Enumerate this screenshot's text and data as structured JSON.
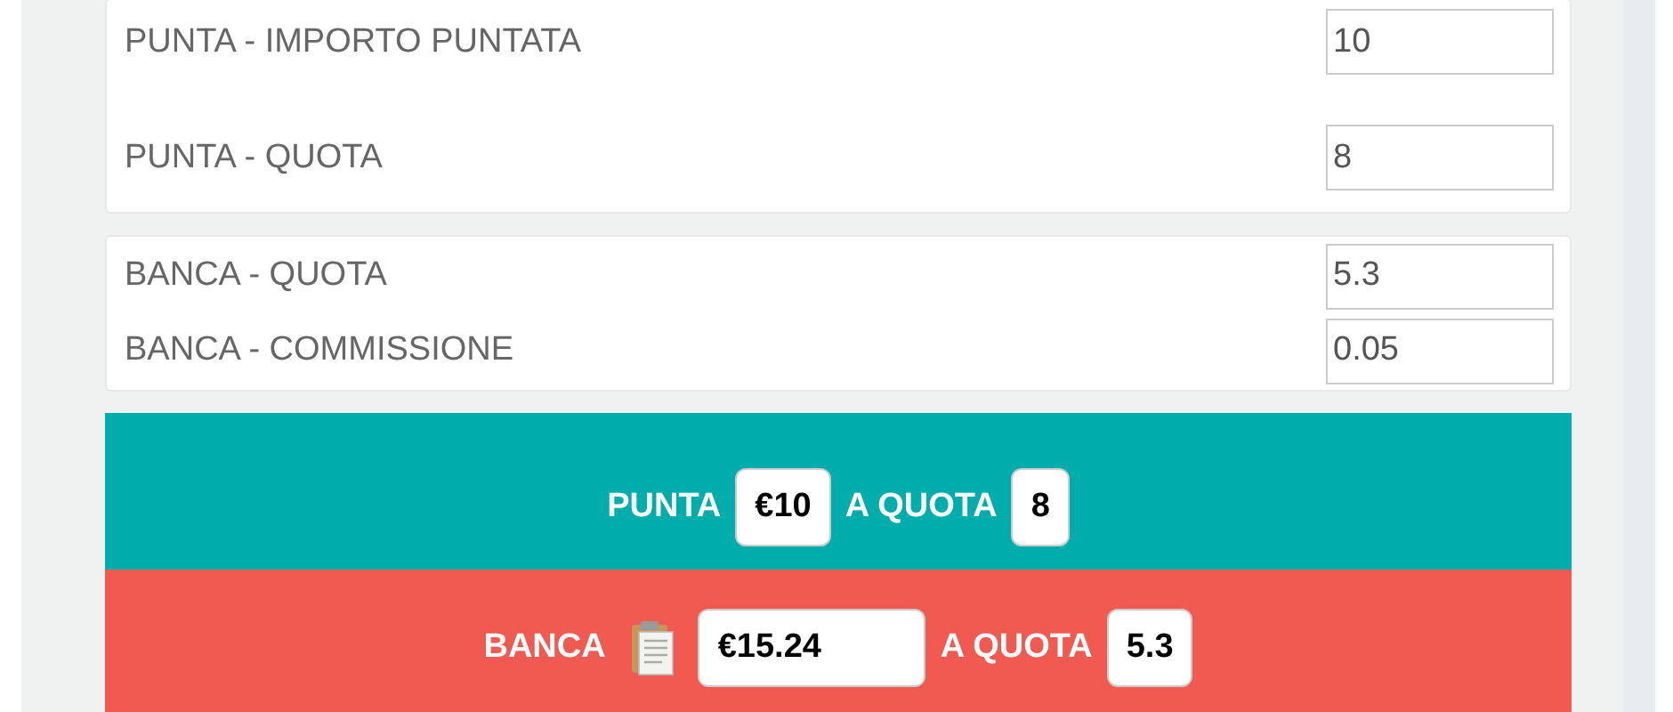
{
  "back_fields": [
    {
      "label": "PUNTA - IMPORTO PUNTATA",
      "value": "10"
    },
    {
      "label": "PUNTA - QUOTA",
      "value": "8"
    }
  ],
  "lay_fields": [
    {
      "label": "BANCA - QUOTA",
      "value": "5.3"
    },
    {
      "label": "BANCA - COMMISSIONE",
      "value": "0.05"
    }
  ],
  "back_result": {
    "label": "PUNTA",
    "amount": "€10",
    "odds_label": "A QUOTA",
    "odds": "8"
  },
  "lay_result": {
    "label": "BANCA",
    "amount": "€15.24",
    "odds_label": "A QUOTA",
    "odds": "5.3"
  }
}
